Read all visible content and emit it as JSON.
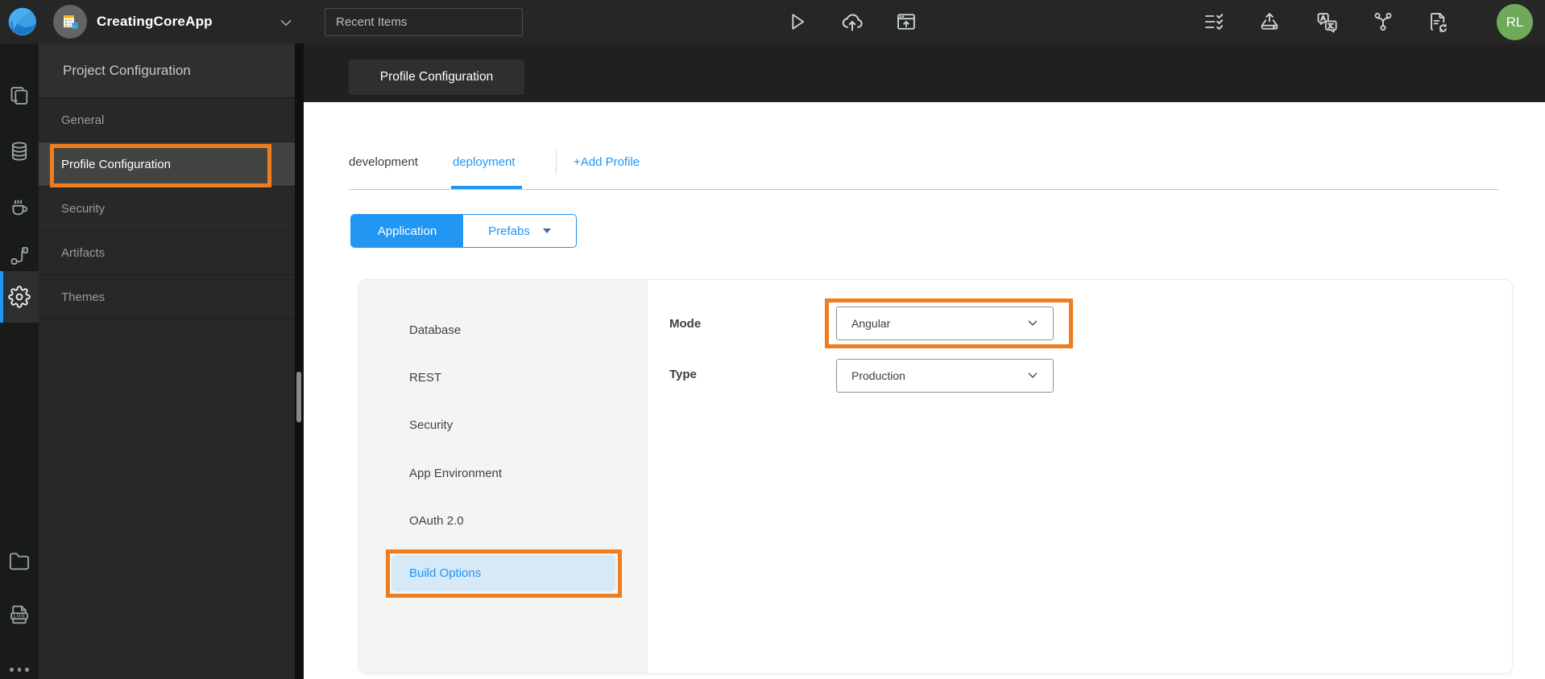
{
  "topbar": {
    "app_name": "CreatingCoreApp",
    "recent_items_placeholder": "Recent Items",
    "avatar_initials": "RL"
  },
  "sidebar": {
    "title": "Project Configuration",
    "items": [
      {
        "label": "General",
        "selected": false
      },
      {
        "label": "Profile Configuration",
        "selected": true
      },
      {
        "label": "Security",
        "selected": false
      },
      {
        "label": "Artifacts",
        "selected": false
      },
      {
        "label": "Themes",
        "selected": false
      }
    ]
  },
  "main": {
    "tab_chip": "Profile Configuration",
    "profile_tabs": {
      "tabs": [
        {
          "label": "development",
          "active": false
        },
        {
          "label": "deployment",
          "active": true
        }
      ],
      "add_profile_label": "+Add Profile"
    },
    "scope_toggle": {
      "application_label": "Application",
      "prefabs_label": "Prefabs",
      "active": "Application"
    },
    "settings_nav": {
      "items": [
        {
          "label": "Database",
          "selected": false
        },
        {
          "label": "REST",
          "selected": false
        },
        {
          "label": "Security",
          "selected": false
        },
        {
          "label": "App Environment",
          "selected": false
        },
        {
          "label": "OAuth 2.0",
          "selected": false
        },
        {
          "label": "Build Options",
          "selected": true
        }
      ]
    },
    "form": {
      "mode": {
        "label": "Mode",
        "value": "Angular"
      },
      "type": {
        "label": "Type",
        "value": "Production"
      }
    }
  },
  "colors": {
    "accent_blue": "#2196f3",
    "annotation_orange": "#ee7d1f",
    "avatar_green": "#6fa95a",
    "selected_nav_bg": "#d7e8f7"
  }
}
